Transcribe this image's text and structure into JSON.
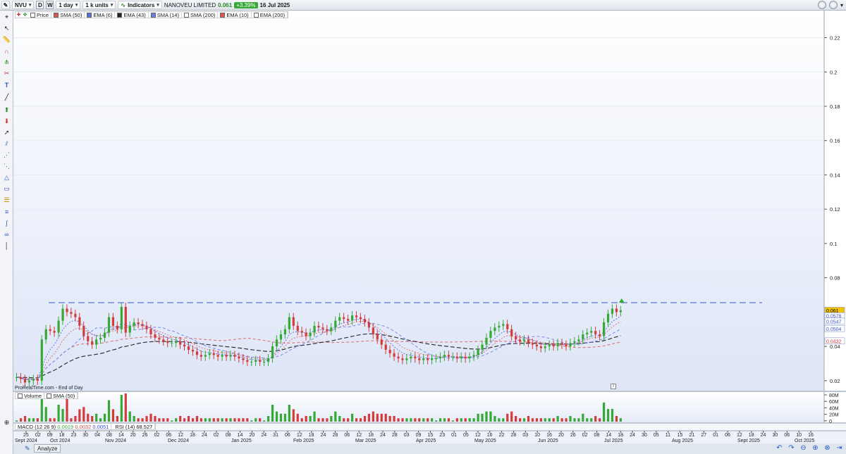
{
  "toolbar": {
    "symbol": "NVU",
    "period_d": "D",
    "period_w": "W",
    "timeframe": "1 day",
    "units": "1 k units",
    "indicators_label": "Indicators",
    "instrument_name": "NANOVEU LIMITED",
    "last_price": "0.061",
    "change": "+3.39%",
    "date": "16 Jul 2025"
  },
  "legend": [
    {
      "label": "Price",
      "color": "#ffffff"
    },
    {
      "label": "SMA (50)",
      "color": "#e05555"
    },
    {
      "label": "EMA (6)",
      "color": "#5b6ee0"
    },
    {
      "label": "EMA (43)",
      "color": "#222222"
    },
    {
      "label": "SMA (14)",
      "color": "#6e7de8"
    },
    {
      "label": "SMA (200)",
      "color": "#ffffff"
    },
    {
      "label": "EMA (10)",
      "color": "#e05555"
    },
    {
      "label": "EMA (200)",
      "color": "#ffffff"
    }
  ],
  "attribution": "ProRealTime.com - End of Day",
  "volume_legend": [
    {
      "label": "Volume",
      "color": "#ffffff"
    },
    {
      "label": "SMA (50)",
      "color": "#ffffff"
    }
  ],
  "macd": {
    "label": "MACD (12 26 9)",
    "v1": "0.0019",
    "v2": "0.0032",
    "v3": "0.0051"
  },
  "rsi": {
    "label": "RSI (14)",
    "value": "68.527"
  },
  "price_axis": [
    "0.22",
    "0.2",
    "0.18",
    "0.16",
    "0.14",
    "0.12",
    "0.1",
    "0.08",
    "0.04",
    "0.02"
  ],
  "price_tags": [
    {
      "value": "0.061",
      "color": "#f2c200",
      "text_color": "#111111"
    },
    {
      "value": "0.0578",
      "color": "#ffffff",
      "text_color": "#3c54c8"
    },
    {
      "value": "0.0547",
      "color": "#ffffff",
      "text_color": "#3c54c8"
    },
    {
      "value": "0.0504",
      "color": "#ffffff",
      "text_color": "#3c54c8"
    },
    {
      "value": "0.0432",
      "color": "#ffffff",
      "text_color": "#d04040"
    }
  ],
  "volume_axis": [
    "80M",
    "60M",
    "40M",
    "20M",
    "0"
  ],
  "date_days": [
    "25",
    "02",
    "09",
    "18",
    "23",
    "30",
    "04",
    "08",
    "14",
    "20",
    "26",
    "02",
    "06",
    "12",
    "18",
    "24",
    "02",
    "08",
    "14",
    "20",
    "24",
    "31",
    "06",
    "12",
    "18",
    "24",
    "28",
    "06",
    "12",
    "18",
    "24",
    "28",
    "03",
    "09",
    "15",
    "23",
    "01",
    "05",
    "12",
    "16",
    "22",
    "28",
    "03",
    "10",
    "16",
    "20",
    "26",
    "02",
    "08",
    "14",
    "18",
    "24",
    "30",
    "05",
    "11",
    "15",
    "21",
    "27",
    "01",
    "06",
    "12",
    "18",
    "24",
    "30",
    "06",
    "10",
    "16"
  ],
  "date_months": [
    "Sept 2024",
    "Oct 2024",
    "Nov 2024",
    "Dec 2024",
    "Jan 2025",
    "Feb 2025",
    "Mar 2025",
    "Apr 2025",
    "May 2025",
    "Jun 2025",
    "Jul 2025",
    "Aug 2025",
    "Sept 2025",
    "Oct 2025"
  ],
  "analyze_label": "Analyze",
  "chart_data": {
    "type": "candlestick",
    "symbol": "NVU",
    "period": "1 day",
    "y_range": [
      0.015,
      0.235
    ],
    "resistance_line": 0.0655,
    "series": [
      {
        "name": "Price",
        "close": [
          0.022,
          0.021,
          0.019,
          0.02,
          0.021,
          0.02,
          0.044,
          0.05,
          0.049,
          0.048,
          0.055,
          0.062,
          0.06,
          0.059,
          0.057,
          0.052,
          0.046,
          0.043,
          0.041,
          0.044,
          0.045,
          0.048,
          0.057,
          0.052,
          0.05,
          0.063,
          0.048,
          0.052,
          0.054,
          0.053,
          0.052,
          0.05,
          0.047,
          0.045,
          0.044,
          0.043,
          0.042,
          0.042,
          0.043,
          0.041,
          0.04,
          0.038,
          0.037,
          0.035,
          0.034,
          0.035,
          0.036,
          0.035,
          0.034,
          0.035,
          0.034,
          0.035,
          0.034,
          0.033,
          0.032,
          0.031,
          0.031,
          0.032,
          0.031,
          0.031,
          0.033,
          0.04,
          0.044,
          0.047,
          0.05,
          0.057,
          0.052,
          0.049,
          0.048,
          0.046,
          0.048,
          0.052,
          0.051,
          0.05,
          0.049,
          0.051,
          0.055,
          0.057,
          0.056,
          0.055,
          0.058,
          0.057,
          0.056,
          0.054,
          0.051,
          0.047,
          0.044,
          0.041,
          0.038,
          0.036,
          0.034,
          0.033,
          0.032,
          0.033,
          0.034,
          0.033,
          0.032,
          0.033,
          0.032,
          0.033,
          0.033,
          0.034,
          0.035,
          0.034,
          0.034,
          0.033,
          0.034,
          0.033,
          0.034,
          0.035,
          0.038,
          0.041,
          0.045,
          0.049,
          0.051,
          0.052,
          0.053,
          0.05,
          0.046,
          0.044,
          0.043,
          0.044,
          0.042,
          0.041,
          0.04,
          0.039,
          0.04,
          0.041,
          0.04,
          0.042,
          0.041,
          0.04,
          0.042,
          0.043,
          0.044,
          0.047,
          0.048,
          0.049,
          0.047,
          0.046,
          0.054,
          0.059,
          0.062,
          0.06,
          0.061
        ]
      },
      {
        "name": "SMA (50)",
        "values": []
      },
      {
        "name": "EMA (6)",
        "values": []
      },
      {
        "name": "EMA (43)",
        "values": []
      },
      {
        "name": "SMA (14)",
        "values": []
      },
      {
        "name": "EMA (10)",
        "values": []
      },
      {
        "name": "Volume",
        "values": []
      }
    ]
  }
}
